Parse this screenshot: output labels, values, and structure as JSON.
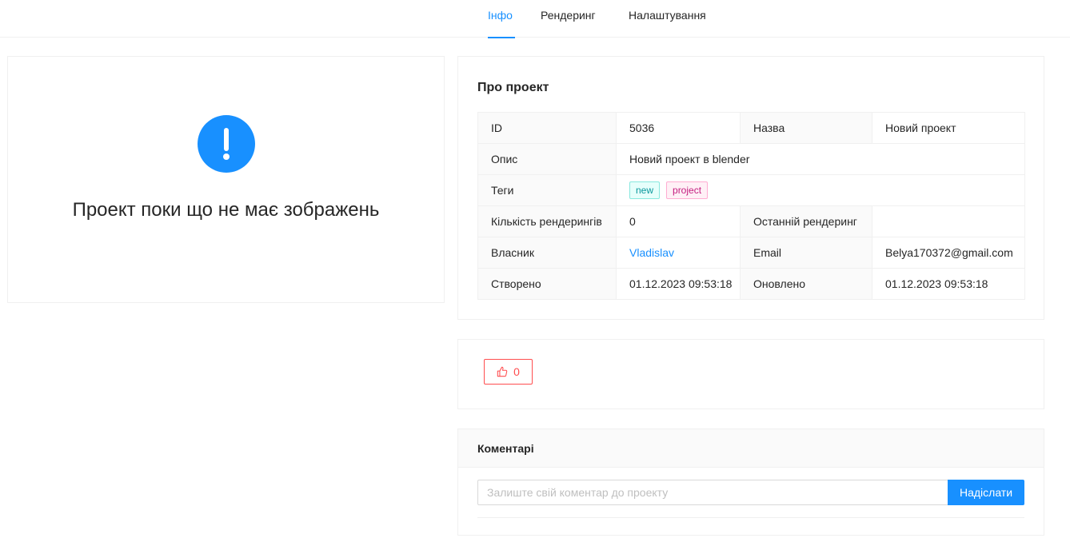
{
  "tabs": [
    {
      "label": "Інфо",
      "active": true
    },
    {
      "label": "Рендеринг",
      "active": false
    },
    {
      "label": "Налаштування",
      "active": false
    }
  ],
  "left": {
    "icon": "exclamation-circle-icon",
    "message": "Проект поки що не має зображень"
  },
  "about": {
    "title": "Про проект",
    "rows": {
      "id_label": "ID",
      "id_value": "5036",
      "name_label": "Назва",
      "name_value": "Новий проект",
      "description_label": "Опис",
      "description_value": "Новий проект в blender",
      "tags_label": "Теги",
      "tags": [
        "new",
        "project"
      ],
      "render_count_label": "Кількість рендерингів",
      "render_count_value": "0",
      "last_render_label": "Останній рендеринг",
      "last_render_value": "",
      "owner_label": "Власник",
      "owner_value": "Vladislav",
      "email_label": "Email",
      "email_value": "Belya170372@gmail.com",
      "created_label": "Створено",
      "created_value": "01.12.2023 09:53:18",
      "updated_label": "Оновлено",
      "updated_value": "01.12.2023 09:53:18"
    }
  },
  "likes": {
    "icon": "thumbs-up-icon",
    "count": "0"
  },
  "comments": {
    "title": "Коментарі",
    "placeholder": "Залиште свій коментар до проекту",
    "value": "",
    "submit_label": "Надіслати"
  },
  "colors": {
    "accent": "#1890ff",
    "danger": "#ff4d4f"
  }
}
